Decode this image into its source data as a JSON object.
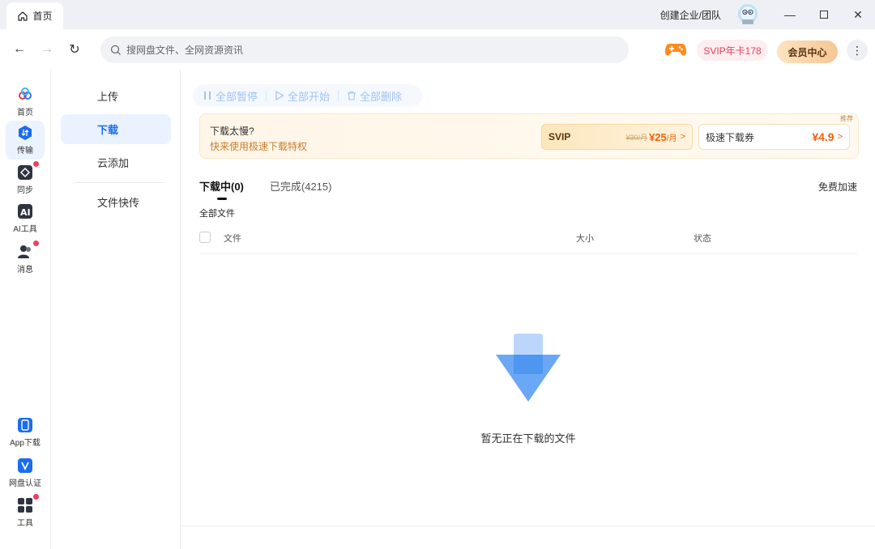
{
  "titlebar": {
    "tab_label": "首页",
    "team_link": "创建企业/团队",
    "window_buttons": [
      "minimize-icon",
      "maximize-icon",
      "close-icon"
    ]
  },
  "navbar": {
    "search_placeholder": "搜网盘文件、全网资源资讯",
    "svip_pill": "SVIP年卡178",
    "vip_center": "会员中心"
  },
  "rail": {
    "items": [
      {
        "label": "首页",
        "icon": "home-cloud-icon"
      },
      {
        "label": "传输",
        "icon": "transfer-icon"
      },
      {
        "label": "同步",
        "icon": "sync-icon"
      },
      {
        "label": "AI工具",
        "icon": "ai-tool-icon"
      },
      {
        "label": "消息",
        "icon": "message-icon"
      },
      {
        "label": "App下载",
        "icon": "app-download-icon"
      },
      {
        "label": "网盘认证",
        "icon": "verify-icon"
      },
      {
        "label": "工具",
        "icon": "tools-icon"
      }
    ]
  },
  "subnav": {
    "items": [
      "上传",
      "下载",
      "云添加",
      "文件快传"
    ]
  },
  "toolbar": {
    "pause_all": "全部暂停",
    "start_all": "全部开始",
    "delete_all": "全部删除"
  },
  "promo": {
    "title": "下载太慢?",
    "subtitle": "快来使用极速下载特权",
    "tag": "推荐",
    "svip": {
      "name": "SVIP",
      "old_price": "¥30/月",
      "price": "¥25",
      "unit": "/月",
      "chevron": ">"
    },
    "ticket": {
      "name": "极速下载券",
      "price": "¥4.9",
      "chevron": ">"
    }
  },
  "tabs": {
    "downloading": "下载中(0)",
    "completed": "已完成(4215)",
    "free_accel": "免费加速"
  },
  "breadcrumb": "全部文件",
  "table": {
    "col_file": "文件",
    "col_size": "大小",
    "col_status": "状态"
  },
  "empty": {
    "message": "暂无正在下载的文件"
  },
  "colors": {
    "accent": "#1a6cf0",
    "svip_red": "#ec3f5b",
    "price_orange": "#f0620a",
    "badge_red": "#f23d5f"
  }
}
